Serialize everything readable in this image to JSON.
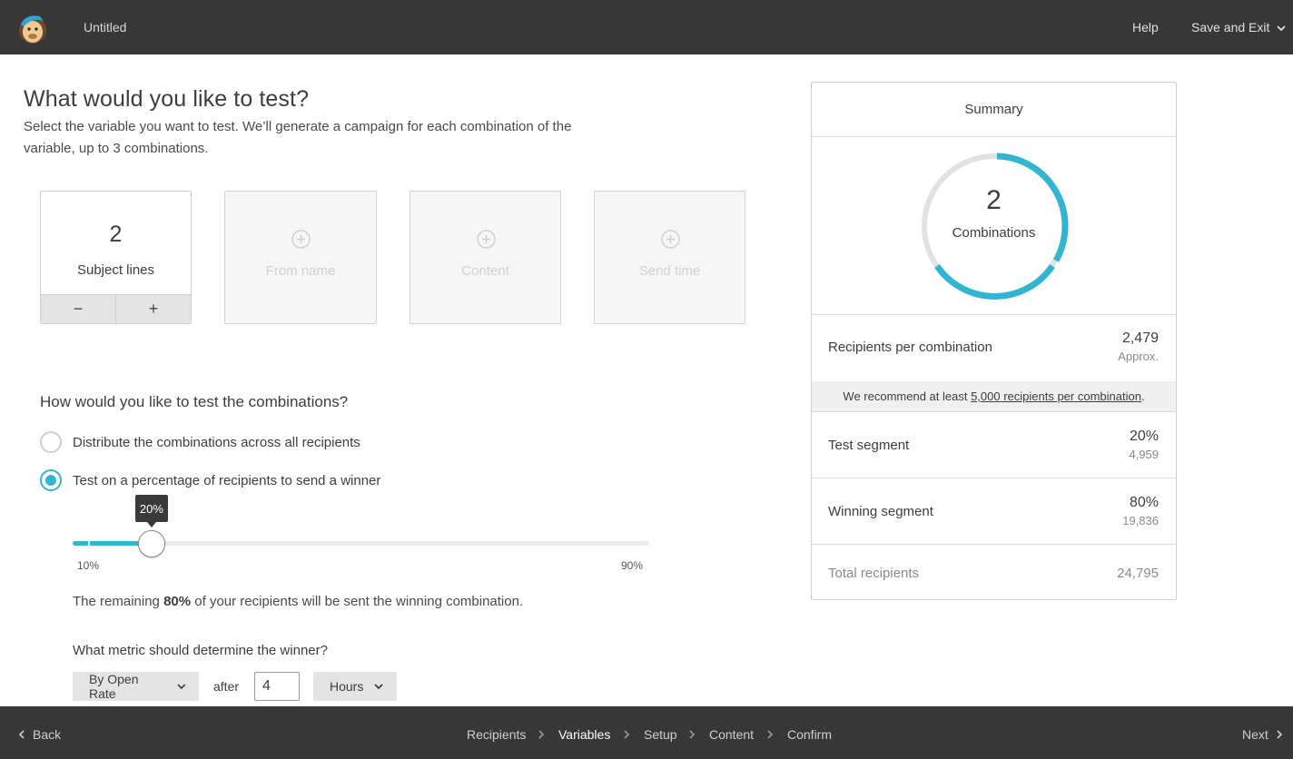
{
  "header": {
    "doc_title": "Untitled",
    "help_label": "Help",
    "save_exit_label": "Save and Exit"
  },
  "main": {
    "heading": "What would you like to test?",
    "intro": "Select the variable you want to test. We’ll generate a campaign for each combination of the variable, up to 3 combinations.",
    "variables": [
      {
        "count": "2",
        "label": "Subject lines",
        "active": true
      },
      {
        "label": "From name",
        "active": false
      },
      {
        "label": "Content",
        "active": false
      },
      {
        "label": "Send time",
        "active": false
      }
    ],
    "stepper": {
      "minus": "−",
      "plus": "+"
    },
    "how_title": "How would you like to test the combinations?",
    "options": [
      {
        "label": "Distribute the combinations across all recipients",
        "checked": false
      },
      {
        "label": "Test on a percentage of recipients to send a winner",
        "checked": true
      }
    ],
    "slider": {
      "value_label": "20%",
      "value": 20,
      "min": 10,
      "max": 90,
      "min_label": "10%",
      "max_label": "90%"
    },
    "remaining": {
      "prefix": "The remaining ",
      "percent": "80%",
      "suffix": " of your recipients will be sent the winning combination."
    },
    "metric_title": "What metric should determine the winner?",
    "metric_select": "By Open Rate",
    "after_label": "after",
    "duration_value": "4",
    "unit_select": "Hours"
  },
  "summary": {
    "title": "Summary",
    "combinations_count": "2",
    "combinations_label": "Combinations",
    "recipients_per_combination_label": "Recipients per combination",
    "recipients_per_combination_value": "2,479",
    "recipients_per_combination_sub": "Approx.",
    "recommend_prefix": "We recommend at least ",
    "recommend_link": "5,000 recipients per combination",
    "recommend_suffix": ".",
    "test_segment_label": "Test segment",
    "test_segment_value": "20%",
    "test_segment_sub": "4,959",
    "winning_segment_label": "Winning segment",
    "winning_segment_value": "80%",
    "winning_segment_sub": "19,836",
    "total_label": "Total recipients",
    "total_value": "24,795",
    "accent_color": "#30b5d2"
  },
  "footer": {
    "back_label": "Back",
    "steps": [
      "Recipients",
      "Variables",
      "Setup",
      "Content",
      "Confirm"
    ],
    "current_step": "Variables",
    "next_label": "Next"
  }
}
